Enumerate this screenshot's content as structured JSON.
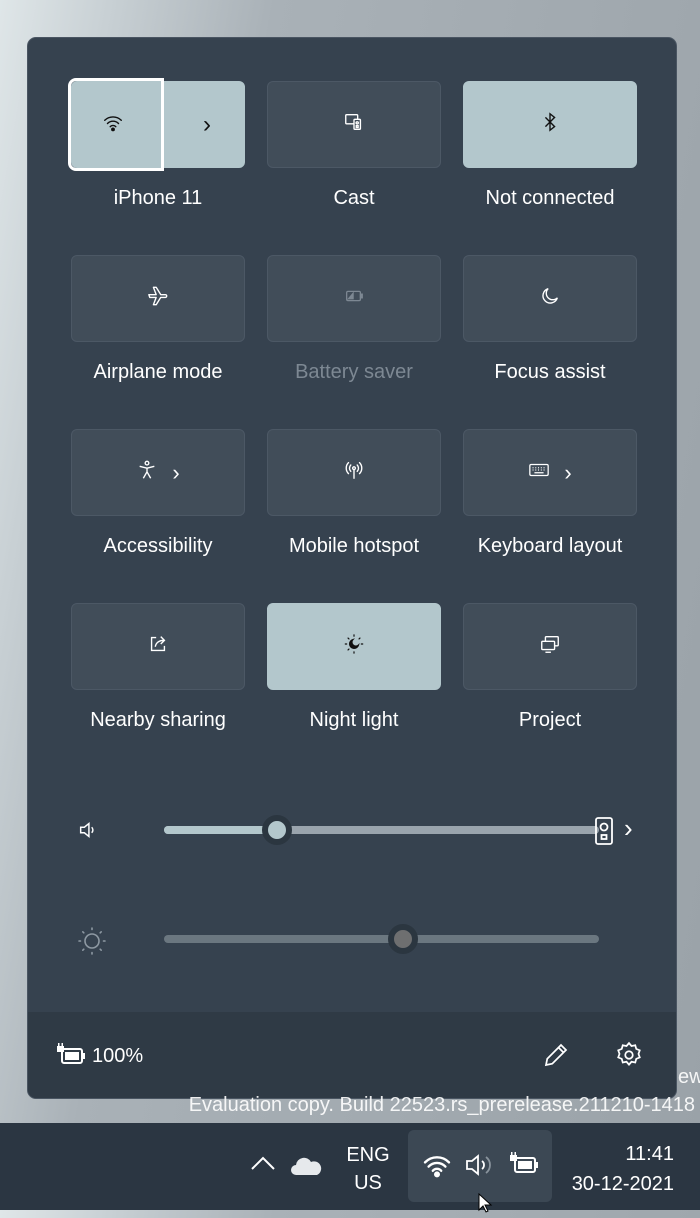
{
  "quick_settings": {
    "tiles": [
      {
        "label": "iPhone 11",
        "icon": "wifi-icon",
        "active": true
      },
      {
        "label": "Cast",
        "icon": "cast-icon",
        "active": false
      },
      {
        "label": "Not connected",
        "icon": "bluetooth-icon",
        "active": true
      },
      {
        "label": "Airplane mode",
        "icon": "airplane-icon",
        "active": false
      },
      {
        "label": "Battery saver",
        "icon": "battery-saver-icon",
        "active": false,
        "disabled": true
      },
      {
        "label": "Focus assist",
        "icon": "moon-icon",
        "active": false
      },
      {
        "label": "Accessibility",
        "icon": "accessibility-icon",
        "active": false
      },
      {
        "label": "Mobile hotspot",
        "icon": "hotspot-icon",
        "active": false
      },
      {
        "label": "Keyboard layout",
        "icon": "keyboard-icon",
        "active": false
      },
      {
        "label": "Nearby sharing",
        "icon": "share-icon",
        "active": false
      },
      {
        "label": "Night light",
        "icon": "night-light-icon",
        "active": true
      },
      {
        "label": "Project",
        "icon": "project-icon",
        "active": false
      }
    ],
    "volume_percent": 26,
    "brightness_percent": 55,
    "battery": "100%"
  },
  "watermark": {
    "line1_fragment": "ew",
    "line2": "Evaluation copy. Build 22523.rs_prerelease.211210-1418"
  },
  "taskbar": {
    "language": "ENG",
    "region": "US",
    "time": "11:41",
    "date": "30-12-2021"
  },
  "colors": {
    "panel": "#36424f",
    "tile_on": "#b3c7cc",
    "tile_off": "#414d59"
  }
}
